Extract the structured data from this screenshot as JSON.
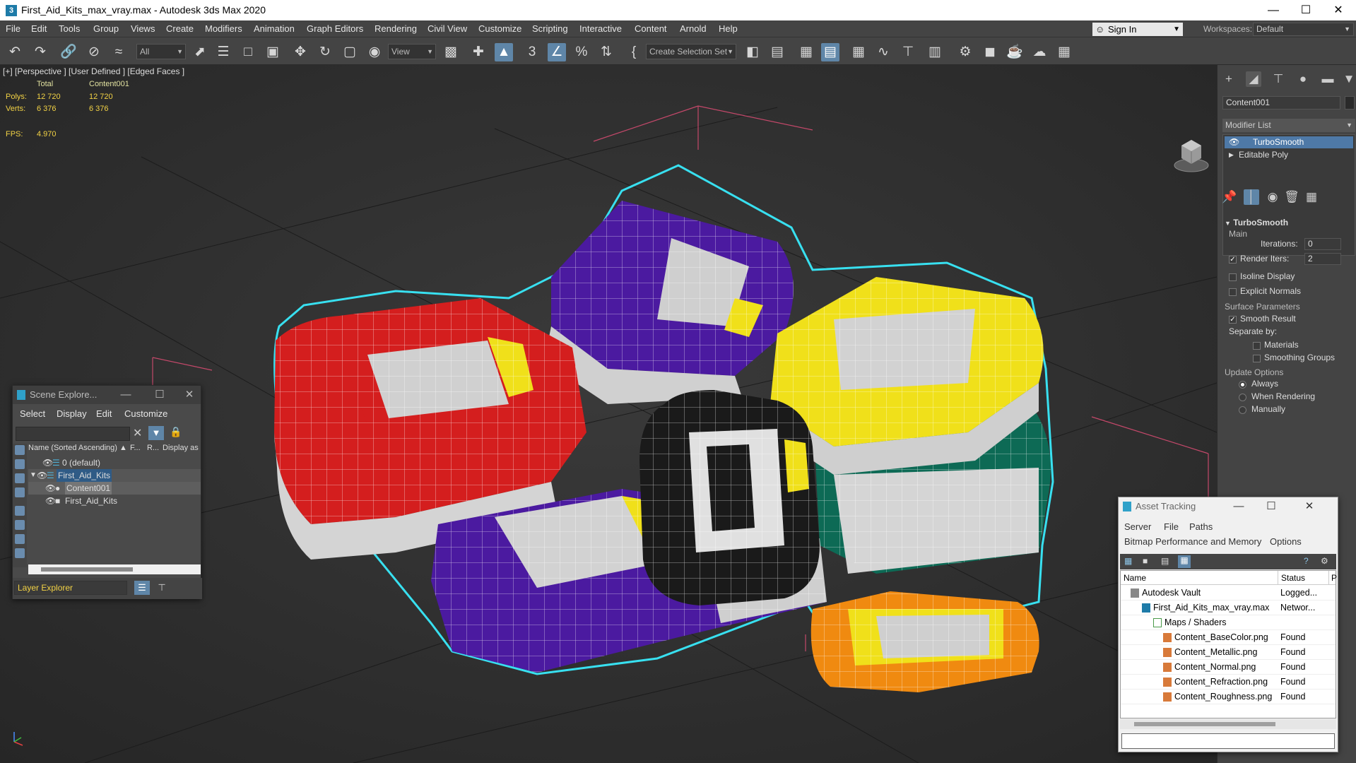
{
  "window": {
    "title": "First_Aid_Kits_max_vray.max - Autodesk 3ds Max 2020",
    "app_icon": "3",
    "minimize": "—",
    "maximize": "☐",
    "close": "✕"
  },
  "menu": [
    "File",
    "Edit",
    "Tools",
    "Group",
    "Views",
    "Create",
    "Modifiers",
    "Animation",
    "Graph Editors",
    "Rendering",
    "Civil View",
    "Customize",
    "Scripting",
    "Interactive",
    "Content",
    "Arnold",
    "Help"
  ],
  "account": {
    "signin": "Sign In",
    "workspaces_label": "Workspaces:",
    "workspace": "Default"
  },
  "toolbar": {
    "filter": "All",
    "ref_coord": "View",
    "selection_set": "Create Selection Set"
  },
  "viewport": {
    "label": "[+] [Perspective ] [User Defined ] [Edged Faces ]",
    "stats": {
      "col_total": "Total",
      "col_object": "Content001",
      "polys_label": "Polys:",
      "polys_total": "12 720",
      "polys_obj": "12 720",
      "verts_label": "Verts:",
      "verts_total": "6 376",
      "verts_obj": "6 376",
      "fps_label": "FPS:",
      "fps": "4.970"
    }
  },
  "scene_explorer": {
    "title": "Scene Explore...",
    "menu": [
      "Select",
      "Display",
      "Edit",
      "Customize"
    ],
    "columns": {
      "name": "Name (Sorted Ascending) ▲",
      "f": "F...",
      "r": "R...",
      "display": "Display as"
    },
    "rows": [
      {
        "label": "0 (default)"
      },
      {
        "label": "First_Aid_Kits"
      },
      {
        "label": "Content001"
      },
      {
        "label": "First_Aid_Kits"
      }
    ],
    "layer_explorer": "Layer Explorer"
  },
  "command_panel": {
    "object_name": "Content001",
    "modifier_list": "Modifier List",
    "stack": [
      {
        "label": "TurboSmooth"
      },
      {
        "label": "Editable Poly"
      }
    ],
    "rollout": "TurboSmooth",
    "main": "Main",
    "iterations_label": "Iterations:",
    "iterations": "0",
    "render_iters_label": "Render Iters:",
    "render_iters": "2",
    "isoline": "Isoline Display",
    "explicit_normals": "Explicit Normals",
    "surface_params": "Surface Parameters",
    "smooth_result": "Smooth Result",
    "separate_by": "Separate by:",
    "materials": "Materials",
    "smoothing_groups": "Smoothing Groups",
    "update_options": "Update Options",
    "always": "Always",
    "when_rendering": "When Rendering",
    "manually": "Manually"
  },
  "asset_tracking": {
    "title": "Asset Tracking",
    "menu": [
      "Server",
      "File",
      "Paths"
    ],
    "menu2": [
      "Bitmap Performance and Memory",
      "Options"
    ],
    "col_name": "Name",
    "col_status": "Status",
    "col_p": "P",
    "rows": [
      {
        "name": "Autodesk Vault",
        "status": "Logged..."
      },
      {
        "name": "First_Aid_Kits_max_vray.max",
        "status": "Networ..."
      },
      {
        "name": "Maps / Shaders",
        "status": ""
      },
      {
        "name": "Content_BaseColor.png",
        "status": "Found"
      },
      {
        "name": "Content_Metallic.png",
        "status": "Found"
      },
      {
        "name": "Content_Normal.png",
        "status": "Found"
      },
      {
        "name": "Content_Refraction.png",
        "status": "Found"
      },
      {
        "name": "Content_Roughness.png",
        "status": "Found"
      }
    ]
  },
  "colors": {
    "selection_outline": "#38e0f0",
    "red_kit": "#d41e1e",
    "purple_kit": "#4b1aa0",
    "yellow_kit": "#f0e01a",
    "green_kit": "#0d6a55",
    "orange_kit": "#f08a10",
    "black_kit": "#1a1a1a",
    "active_tool": "#5f86a8"
  }
}
